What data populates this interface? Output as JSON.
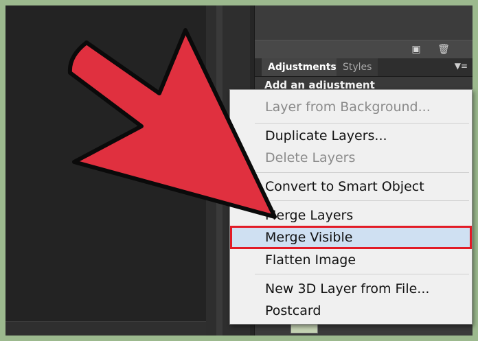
{
  "panel": {
    "tabs": [
      {
        "label": "Adjustments",
        "active": true
      },
      {
        "label": "Styles",
        "active": false
      }
    ],
    "heading": "Add an adjustment",
    "icons": [
      "new-layer-icon",
      "trash-icon",
      "panel-menu-icon"
    ]
  },
  "menu": {
    "items": [
      {
        "label": "Layer from Background...",
        "enabled": false
      },
      {
        "label": "Duplicate Layers...",
        "enabled": true
      },
      {
        "label": "Delete Layers",
        "enabled": false
      },
      {
        "label": "Convert to Smart Object",
        "enabled": true
      },
      {
        "label": "Merge Layers",
        "enabled": true
      },
      {
        "label": "Merge Visible",
        "enabled": true,
        "highlighted": true
      },
      {
        "label": "Flatten Image",
        "enabled": true
      },
      {
        "label": "New 3D Layer from File...",
        "enabled": true
      },
      {
        "label": "Postcard",
        "enabled": true
      }
    ]
  },
  "colors": {
    "arrow": "#e0303f",
    "highlight_border": "#e21b26",
    "highlight_fill": "#cfe0f2",
    "menu_background": "#f0f0f0",
    "border": "#9cb98e"
  }
}
